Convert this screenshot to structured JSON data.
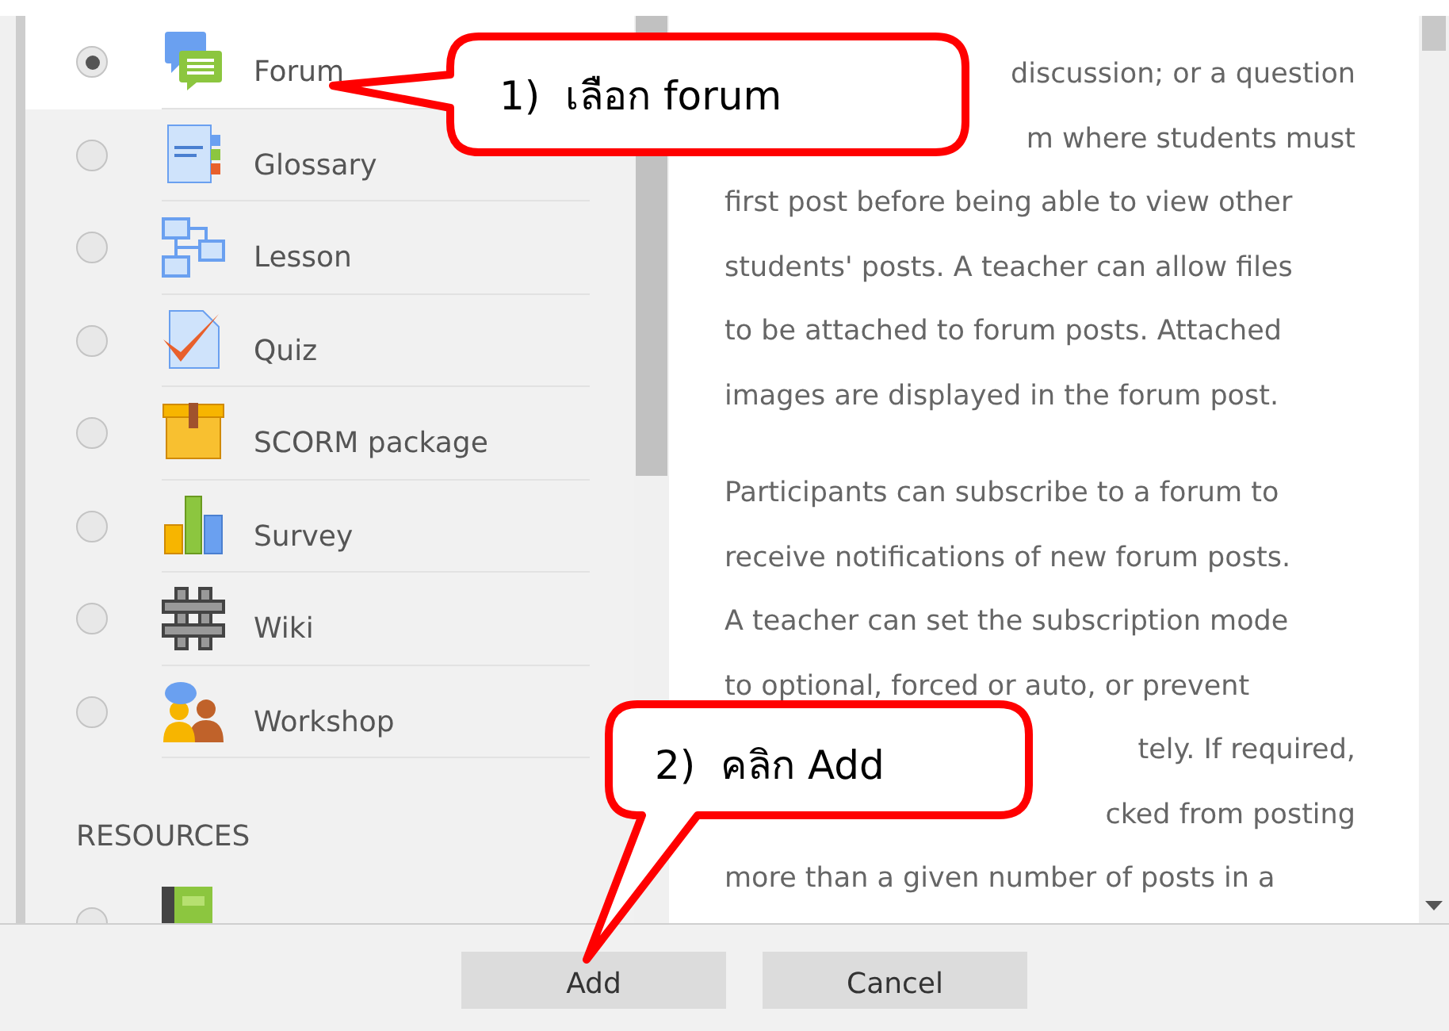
{
  "activities": [
    {
      "label": "Forum",
      "selected": true
    },
    {
      "label": "Glossary",
      "selected": false
    },
    {
      "label": "Lesson",
      "selected": false
    },
    {
      "label": "Quiz",
      "selected": false
    },
    {
      "label": "SCORM package",
      "selected": false
    },
    {
      "label": "Survey",
      "selected": false
    },
    {
      "label": "Wiki",
      "selected": false
    },
    {
      "label": "Workshop",
      "selected": false
    }
  ],
  "resources": {
    "heading": "RESOURCES",
    "items": [
      {
        "selected": false
      }
    ]
  },
  "description": [
    {
      "kind": "partial",
      "text": "discussion; or a question"
    },
    {
      "kind": "partial",
      "text": "m where students must"
    },
    {
      "kind": "full",
      "text": "first post before being able to view other"
    },
    {
      "kind": "full",
      "text": "students' posts. A teacher can allow files"
    },
    {
      "kind": "full",
      "text": "to be attached to forum posts. Attached"
    },
    {
      "kind": "full",
      "text": "images are displayed in the forum post."
    },
    {
      "kind": "gap"
    },
    {
      "kind": "full",
      "text": "Participants can subscribe to a forum to"
    },
    {
      "kind": "full",
      "text": "receive notifications of new forum posts."
    },
    {
      "kind": "full",
      "text": "A teacher can set the subscription mode"
    },
    {
      "kind": "full",
      "text": "to optional, forced or auto, or prevent"
    },
    {
      "kind": "partial",
      "text": "tely. If required,"
    },
    {
      "kind": "partial",
      "text": "cked from posting"
    },
    {
      "kind": "full",
      "text": "more than a given number of posts in a"
    }
  ],
  "buttons": [
    "Add",
    "Cancel"
  ],
  "callouts": [
    "1)  เลือก forum",
    "2)  คลิก Add"
  ]
}
